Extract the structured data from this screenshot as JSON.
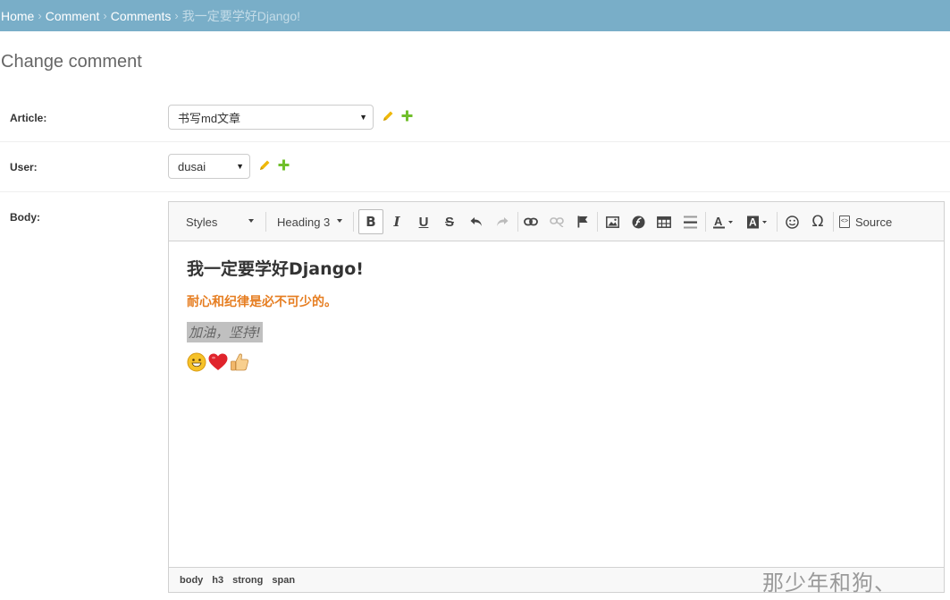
{
  "breadcrumbs": {
    "items": [
      "Home",
      "Comment",
      "Comments"
    ],
    "separator": "›",
    "current": "我一定要学好Django!"
  },
  "page": {
    "title": "Change comment"
  },
  "fields": {
    "article": {
      "label": "Article:",
      "value": "书写md文章"
    },
    "user": {
      "label": "User:",
      "value": "dusai"
    },
    "body": {
      "label": "Body:"
    }
  },
  "editor": {
    "styles_label": "Styles",
    "format_label": "Heading 3",
    "source_label": "Source",
    "content": {
      "heading": "我一定要学好Django!",
      "strong": "耐心和纪律是必不可少的。",
      "italic": "加油，坚持!"
    },
    "elements_path": [
      "body",
      "h3",
      "strong",
      "span"
    ]
  },
  "watermark": "那少年和狗、",
  "colors": {
    "breadcrumb_bg": "#79aec8",
    "strong_text": "#e67e22",
    "edit_icon": "#efb80b",
    "add_icon": "#70bf2b"
  }
}
